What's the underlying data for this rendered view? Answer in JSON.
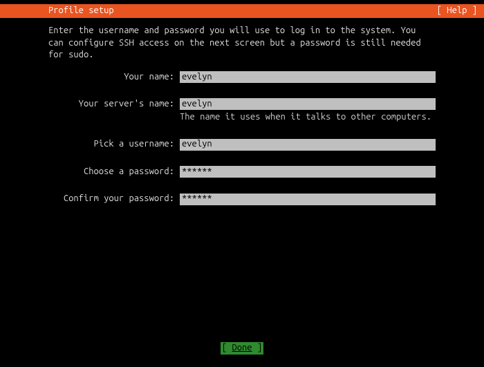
{
  "header": {
    "title": "Profile setup",
    "help": "[ Help ]"
  },
  "intro": "Enter the username and password you will use to log in to the system. You can configure SSH access on the next screen but a password is still needed for sudo.",
  "fields": {
    "name": {
      "label": "Your name:",
      "value": "evelyn"
    },
    "server": {
      "label": "Your server's name:",
      "value": "evelyn",
      "hint": "The name it uses when it talks to other computers."
    },
    "username": {
      "label": "Pick a username:",
      "value": "evelyn"
    },
    "password": {
      "label": "Choose a password:",
      "value": "******"
    },
    "confirm": {
      "label": "Confirm your password:",
      "value": "******"
    }
  },
  "footer": {
    "done_open": "[ ",
    "done_label": "Done",
    "done_close": "       ]"
  },
  "colors": {
    "accent": "#e95420",
    "action": "#2f8a2f",
    "input_bg": "#bfbfbf"
  }
}
